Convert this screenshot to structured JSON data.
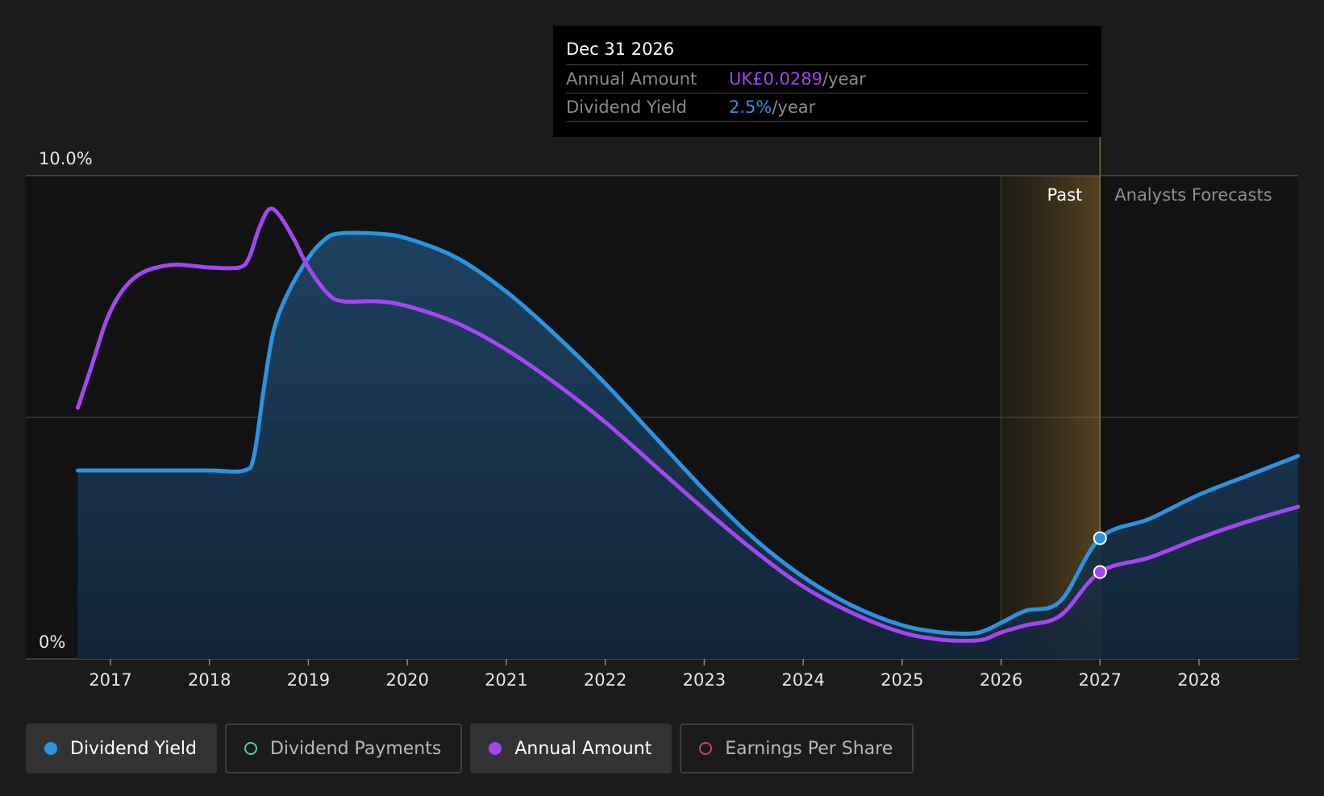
{
  "tooltip": {
    "date": "Dec 31 2026",
    "rows": [
      {
        "label": "Annual Amount",
        "value": "UK£0.0289",
        "unit": "/year",
        "color": "#a347f0"
      },
      {
        "label": "Dividend Yield",
        "value": "2.5%",
        "unit": "/year",
        "color": "#2b94e0"
      }
    ]
  },
  "legend": [
    {
      "label": "Dividend Yield",
      "color": "#2b94e0",
      "filled": true,
      "active": true
    },
    {
      "label": "Dividend Payments",
      "color": "#5dc4b6",
      "filled": false,
      "active": false
    },
    {
      "label": "Annual Amount",
      "color": "#a347f0",
      "filled": true,
      "active": true
    },
    {
      "label": "Earnings Per Share",
      "color": "#c0447f",
      "filled": false,
      "active": false
    }
  ],
  "chart_data": {
    "type": "line",
    "y_tick_labels": [
      "10.0%",
      "0%"
    ],
    "y_ticks": [
      10,
      0
    ],
    "ylim": [
      0,
      10
    ],
    "xlim": [
      2016.67,
      2029.0
    ],
    "x_ticks": [
      2017,
      2018,
      2019,
      2020,
      2021,
      2022,
      2023,
      2024,
      2025,
      2026,
      2027,
      2028
    ],
    "x_tick_labels": [
      "2017",
      "2018",
      "2019",
      "2020",
      "2021",
      "2022",
      "2023",
      "2024",
      "2025",
      "2026",
      "2027",
      "2028"
    ],
    "grid_y": [
      0,
      5,
      10
    ],
    "region_labels": {
      "past": "Past",
      "forecast": "Analysts Forecasts"
    },
    "past_region": [
      2026.0,
      2027.0
    ],
    "marker_x": 2027.0,
    "series": [
      {
        "name": "Dividend Yield",
        "color": "#2b94e0",
        "area": true,
        "points": [
          [
            2016.67,
            3.9
          ],
          [
            2017.0,
            3.9
          ],
          [
            2017.5,
            3.9
          ],
          [
            2018.0,
            3.9
          ],
          [
            2018.35,
            3.9
          ],
          [
            2018.45,
            4.2
          ],
          [
            2018.55,
            5.6
          ],
          [
            2018.65,
            6.8
          ],
          [
            2018.8,
            7.6
          ],
          [
            2019.0,
            8.3
          ],
          [
            2019.15,
            8.65
          ],
          [
            2019.3,
            8.8
          ],
          [
            2019.7,
            8.8
          ],
          [
            2020.0,
            8.7
          ],
          [
            2020.5,
            8.3
          ],
          [
            2021.0,
            7.6
          ],
          [
            2021.5,
            6.7
          ],
          [
            2022.0,
            5.7
          ],
          [
            2022.5,
            4.6
          ],
          [
            2023.0,
            3.5
          ],
          [
            2023.5,
            2.5
          ],
          [
            2024.0,
            1.7
          ],
          [
            2024.5,
            1.1
          ],
          [
            2025.0,
            0.7
          ],
          [
            2025.4,
            0.55
          ],
          [
            2025.7,
            0.53
          ],
          [
            2025.85,
            0.6
          ],
          [
            2026.0,
            0.75
          ],
          [
            2026.25,
            1.0
          ],
          [
            2026.6,
            1.2
          ],
          [
            2027.0,
            2.5
          ],
          [
            2027.5,
            2.9
          ],
          [
            2028.0,
            3.4
          ],
          [
            2028.5,
            3.8
          ],
          [
            2029.0,
            4.2
          ]
        ]
      },
      {
        "name": "Annual Amount",
        "color": "#a347f0",
        "area": false,
        "points": [
          [
            2016.67,
            5.2
          ],
          [
            2016.8,
            6.0
          ],
          [
            2017.0,
            7.2
          ],
          [
            2017.25,
            7.9
          ],
          [
            2017.6,
            8.15
          ],
          [
            2018.0,
            8.1
          ],
          [
            2018.3,
            8.1
          ],
          [
            2018.4,
            8.3
          ],
          [
            2018.5,
            8.9
          ],
          [
            2018.6,
            9.3
          ],
          [
            2018.7,
            9.2
          ],
          [
            2018.85,
            8.7
          ],
          [
            2019.0,
            8.1
          ],
          [
            2019.2,
            7.55
          ],
          [
            2019.35,
            7.4
          ],
          [
            2019.7,
            7.4
          ],
          [
            2020.0,
            7.3
          ],
          [
            2020.5,
            6.95
          ],
          [
            2021.0,
            6.4
          ],
          [
            2021.5,
            5.7
          ],
          [
            2022.0,
            4.9
          ],
          [
            2022.5,
            4.0
          ],
          [
            2023.0,
            3.1
          ],
          [
            2023.5,
            2.25
          ],
          [
            2024.0,
            1.5
          ],
          [
            2024.5,
            0.95
          ],
          [
            2025.0,
            0.55
          ],
          [
            2025.4,
            0.4
          ],
          [
            2025.7,
            0.38
          ],
          [
            2025.85,
            0.42
          ],
          [
            2026.0,
            0.55
          ],
          [
            2026.25,
            0.7
          ],
          [
            2026.6,
            0.9
          ],
          [
            2027.0,
            1.8
          ],
          [
            2027.5,
            2.1
          ],
          [
            2028.0,
            2.5
          ],
          [
            2028.5,
            2.85
          ],
          [
            2029.0,
            3.15
          ]
        ]
      }
    ]
  }
}
